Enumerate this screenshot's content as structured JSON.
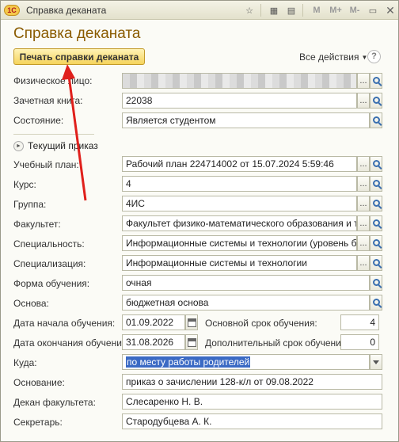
{
  "window": {
    "title": "Справка деканата",
    "logo": "1С",
    "toolbar_icons": [
      "star-icon",
      "calculator-icon",
      "calendar-icon",
      "M",
      "M+",
      "M-",
      "restore-icon",
      "close-icon"
    ]
  },
  "form": {
    "title": "Справка деканата",
    "print_button": "Печать справки деканата",
    "all_actions": "Все действия",
    "help": "?"
  },
  "fields": {
    "person": {
      "label": "Физическое лицо:",
      "value": ""
    },
    "record_book": {
      "label": "Зачетная книга:",
      "value": "22038"
    },
    "state": {
      "label": "Состояние:",
      "value": "Является студентом"
    },
    "current_order": {
      "label": "Текущий приказ"
    },
    "study_plan": {
      "label": "Учебный план:",
      "value": "Рабочий план 224714002 от 15.07.2024 5:59:46"
    },
    "course": {
      "label": "Курс:",
      "value": "4"
    },
    "group": {
      "label": "Группа:",
      "value": "4ИС"
    },
    "faculty": {
      "label": "Факультет:",
      "value": "Факультет физико-математического образования и техн"
    },
    "specialty": {
      "label": "Специальность:",
      "value": "Информационные системы и технологии (уровень бакала"
    },
    "specialization": {
      "label": "Специализация:",
      "value": "Информационные системы и технологии"
    },
    "study_form": {
      "label": "Форма обучения:",
      "value": "очная"
    },
    "basis": {
      "label": "Основа:",
      "value": "бюджетная основа"
    },
    "start_date": {
      "label": "Дата начала обучения:",
      "value": "01.09.2022"
    },
    "main_term": {
      "label": "Основной срок обучения:",
      "value": "4"
    },
    "end_date": {
      "label": "Дата окончания обучения:",
      "value": "31.08.2026"
    },
    "extra_term": {
      "label": "Дополнительный срок обучения:",
      "value": "0"
    },
    "destination": {
      "label": "Куда:",
      "value": "по месту работы родителей"
    },
    "reason": {
      "label": "Основание:",
      "value": "приказ о зачислении 128-к/л от 09.08.2022"
    },
    "dean": {
      "label": "Декан факультета:",
      "value": "Слесаренко Н. В."
    },
    "secretary": {
      "label": "Секретарь:",
      "value": "Стародубцева А. К."
    }
  },
  "colors": {
    "title": "#8a5b00",
    "print_button": "#f5d35c",
    "annotation_arrow": "#e0201c",
    "selection": "#3b6ac4"
  }
}
